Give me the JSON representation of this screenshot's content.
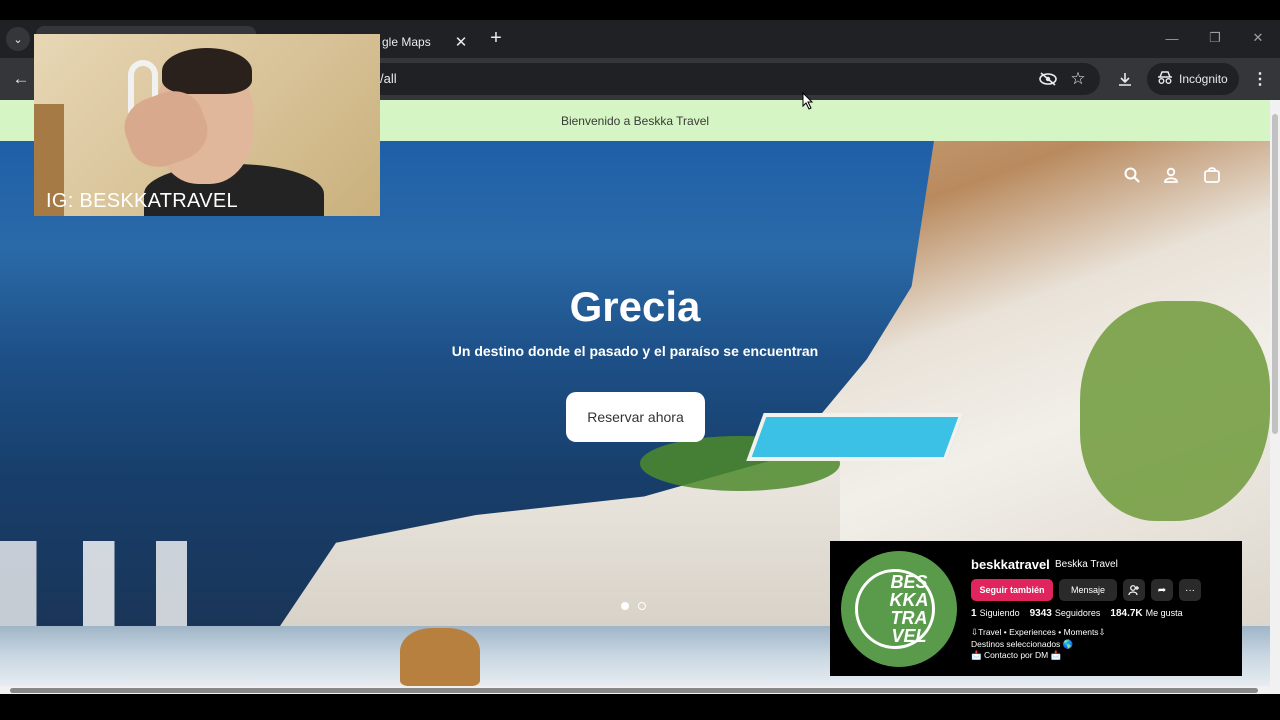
{
  "browser": {
    "tabs": [
      {
        "label": ""
      },
      {
        "label": "gle Maps"
      }
    ],
    "url": "/all",
    "incognito_label": "Incógnito"
  },
  "store": {
    "announcement": "Bienvenido a Beskka Travel",
    "hero": {
      "title": "Grecia",
      "subtitle": "Un destino donde el pasado y el paraíso se encuentran",
      "cta": "Reservar ahora"
    },
    "carousel": {
      "slides": 2,
      "active": 1
    }
  },
  "webcam": {
    "label": "IG: BESKKATRAVEL"
  },
  "instagram": {
    "logo_text": "BES\nKKA\nTRA\nVEL",
    "username": "beskkatravel",
    "display_name": "Beskka Travel",
    "follow_label": "Seguir también",
    "message_label": "Mensaje",
    "stats": [
      {
        "value": "1",
        "label": "Siguiendo"
      },
      {
        "value": "9343",
        "label": "Seguidores"
      },
      {
        "value": "184.7K",
        "label": "Me gusta"
      }
    ],
    "bio": [
      "⇩Travel • Experiences • Moments⇩",
      "Destinos seleccionados 🌎",
      "📩 Contacto por DM 📩"
    ]
  },
  "colors": {
    "announcement_bg": "#d6f5c4",
    "follow_button": "#e0245e",
    "logo_green": "#5a9a4b"
  },
  "icons": [
    "tab-search-icon",
    "close-icon",
    "plus-icon",
    "back-icon",
    "eye-off-icon",
    "star-icon",
    "download-icon",
    "incognito-icon",
    "more-vert-icon",
    "search-icon",
    "account-icon",
    "bag-icon"
  ]
}
